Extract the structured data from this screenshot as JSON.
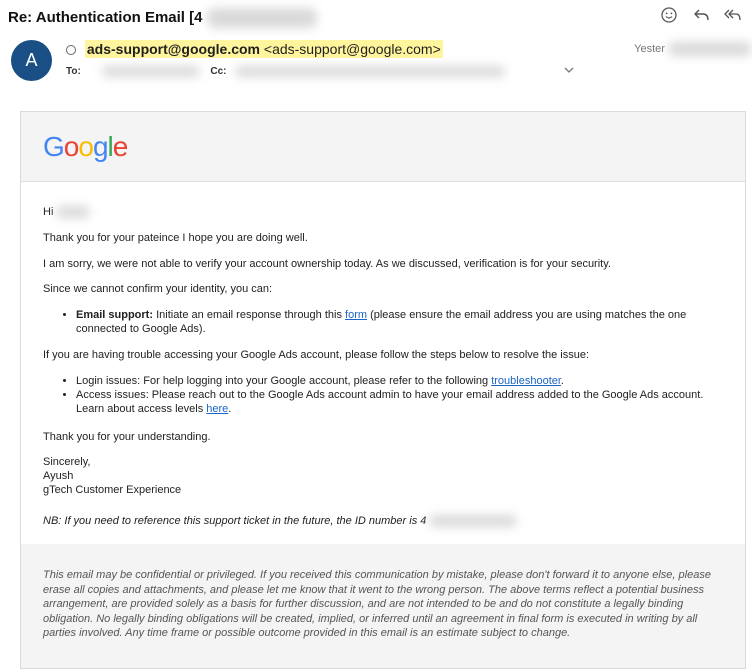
{
  "header": {
    "subject_prefix": "Re: Authentication Email [4"
  },
  "icons": {
    "emoji": "smiley-icon",
    "reply": "reply-icon",
    "reply_all": "reply-all-icon",
    "expand": "chevron-down-icon"
  },
  "sender": {
    "avatar_letter": "A",
    "name": "ads-support@google.com",
    "address": "<ads-support@google.com>",
    "timestamp": "Yester"
  },
  "recipients": {
    "to_label": "To:",
    "cc_label": "Cc:"
  },
  "logo": {
    "g1": "G",
    "o1": "o",
    "o2": "o",
    "g2": "g",
    "l": "l",
    "e": "e"
  },
  "body": {
    "greeting": "Hi",
    "line1": "Thank you for your pateince I hope you are doing well.",
    "line2": "I am sorry, we were not able to verify your account ownership today. As we discussed, verification is for your security.",
    "line3": "Since we cannot confirm your identity, you can:",
    "support_label": "Email support:",
    "support_text_before": " Initiate an email response through this ",
    "support_link": "form",
    "support_text_after": " (please ensure the email address you are using matches the one connected to Google Ads).",
    "line4": "If you are having trouble accessing your Google Ads account, please follow the steps below to resolve the issue:",
    "login_text": "Login issues: For help logging into your Google account, please refer to the following ",
    "login_link": "troubleshooter",
    "login_end": ".",
    "access_text": "Access issues: Please reach out to the Google Ads account admin to have your email address added to the Google Ads account. Learn about access levels ",
    "access_link": "here",
    "access_end": ".",
    "thanks": "Thank you for your understanding.",
    "sincerely": "Sincerely,",
    "sig_name": "Ayush",
    "sig_team": "gTech Customer Experience",
    "nb_text": "NB: If you need to reference this support ticket in the future, the ID number is 4"
  },
  "footer": {
    "disclaimer": "This email may be confidential or privileged. If you received this communication by mistake, please don't forward it to anyone else, please erase all copies and attachments, and please let me know that it went to the wrong person. The above terms reflect a potential business arrangement, are provided solely as a basis for further discussion, and are not intended to be and do not constitute a legally binding obligation. No legally binding obligations will be created, implied, or inferred until an agreement in final form is executed in writing by all parties involved. Any time frame or possible outcome provided in this email is an estimate subject to change."
  }
}
